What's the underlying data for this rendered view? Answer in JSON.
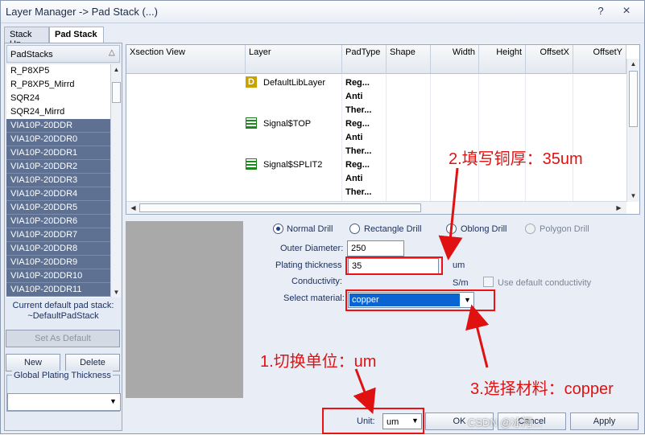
{
  "window": {
    "title": "Layer Manager -> Pad Stack (...)",
    "help_icon": "?",
    "close_icon": "×"
  },
  "tabs": [
    {
      "label": "Stack Up"
    },
    {
      "label": "Pad Stack"
    }
  ],
  "padstacks": {
    "header": "PadStacks",
    "items": [
      "R_P8XP5",
      "R_P8XP5_Mirrd",
      "SQR24",
      "SQR24_Mirrd",
      "VIA10P-20DDR",
      "VIA10P-20DDR0",
      "VIA10P-20DDR1",
      "VIA10P-20DDR2",
      "VIA10P-20DDR3",
      "VIA10P-20DDR4",
      "VIA10P-20DDR5",
      "VIA10P-20DDR6",
      "VIA10P-20DDR7",
      "VIA10P-20DDR8",
      "VIA10P-20DDR9",
      "VIA10P-20DDR10",
      "VIA10P-20DDR11"
    ],
    "selected_from": 4,
    "current_default_label": "Current default pad stack:",
    "current_default_value": "~DefaultPadStack",
    "set_default_label": "Set As Default",
    "new_label": "New",
    "delete_label": "Delete",
    "global_plating_label": "Global Plating Thickness",
    "global_plating_value": ""
  },
  "grid": {
    "columns": [
      "Xsection View",
      "Layer",
      "PadType",
      "Shape",
      "Width",
      "Height",
      "OffsetX",
      "OffsetY"
    ],
    "rows": [
      {
        "layer": "DefaultLibLayer",
        "layer_icon": "D",
        "padtypes": [
          "Reg...",
          "Anti",
          "Ther..."
        ]
      },
      {
        "layer": "Signal$TOP",
        "layer_icon": "signal",
        "padtypes": [
          "Reg...",
          "Anti",
          "Ther..."
        ]
      },
      {
        "layer": "Signal$SPLIT2",
        "layer_icon": "signal",
        "padtypes": [
          "Reg...",
          "Anti",
          "Ther..."
        ]
      }
    ]
  },
  "drill": {
    "options": [
      "Normal Drill",
      "Rectangle Drill",
      "Oblong Drill",
      "Polygon Drill"
    ],
    "selected": "Normal Drill",
    "outer_diameter_label": "Outer Diameter:",
    "outer_diameter_value": "250",
    "plating_label": "Plating thickness",
    "plating_value": "35",
    "plating_unit": "um",
    "conductivity_label": "Conductivity:",
    "conductivity_unit": "S/m",
    "use_default_label": "Use default conductivity",
    "material_label": "Select material:",
    "material_value": "copper"
  },
  "footer": {
    "unit_label": "Unit:",
    "unit_value": "um",
    "ok_label": "OK",
    "cancel_label": "Cancel",
    "apply_label": "Apply",
    "watermark": "CSDN @冰河…"
  },
  "annotations": {
    "a1": "1.切换单位：um",
    "a2": "2.填写铜厚：35um",
    "a3": "3.选择材料：copper",
    "color": "#e01111"
  }
}
